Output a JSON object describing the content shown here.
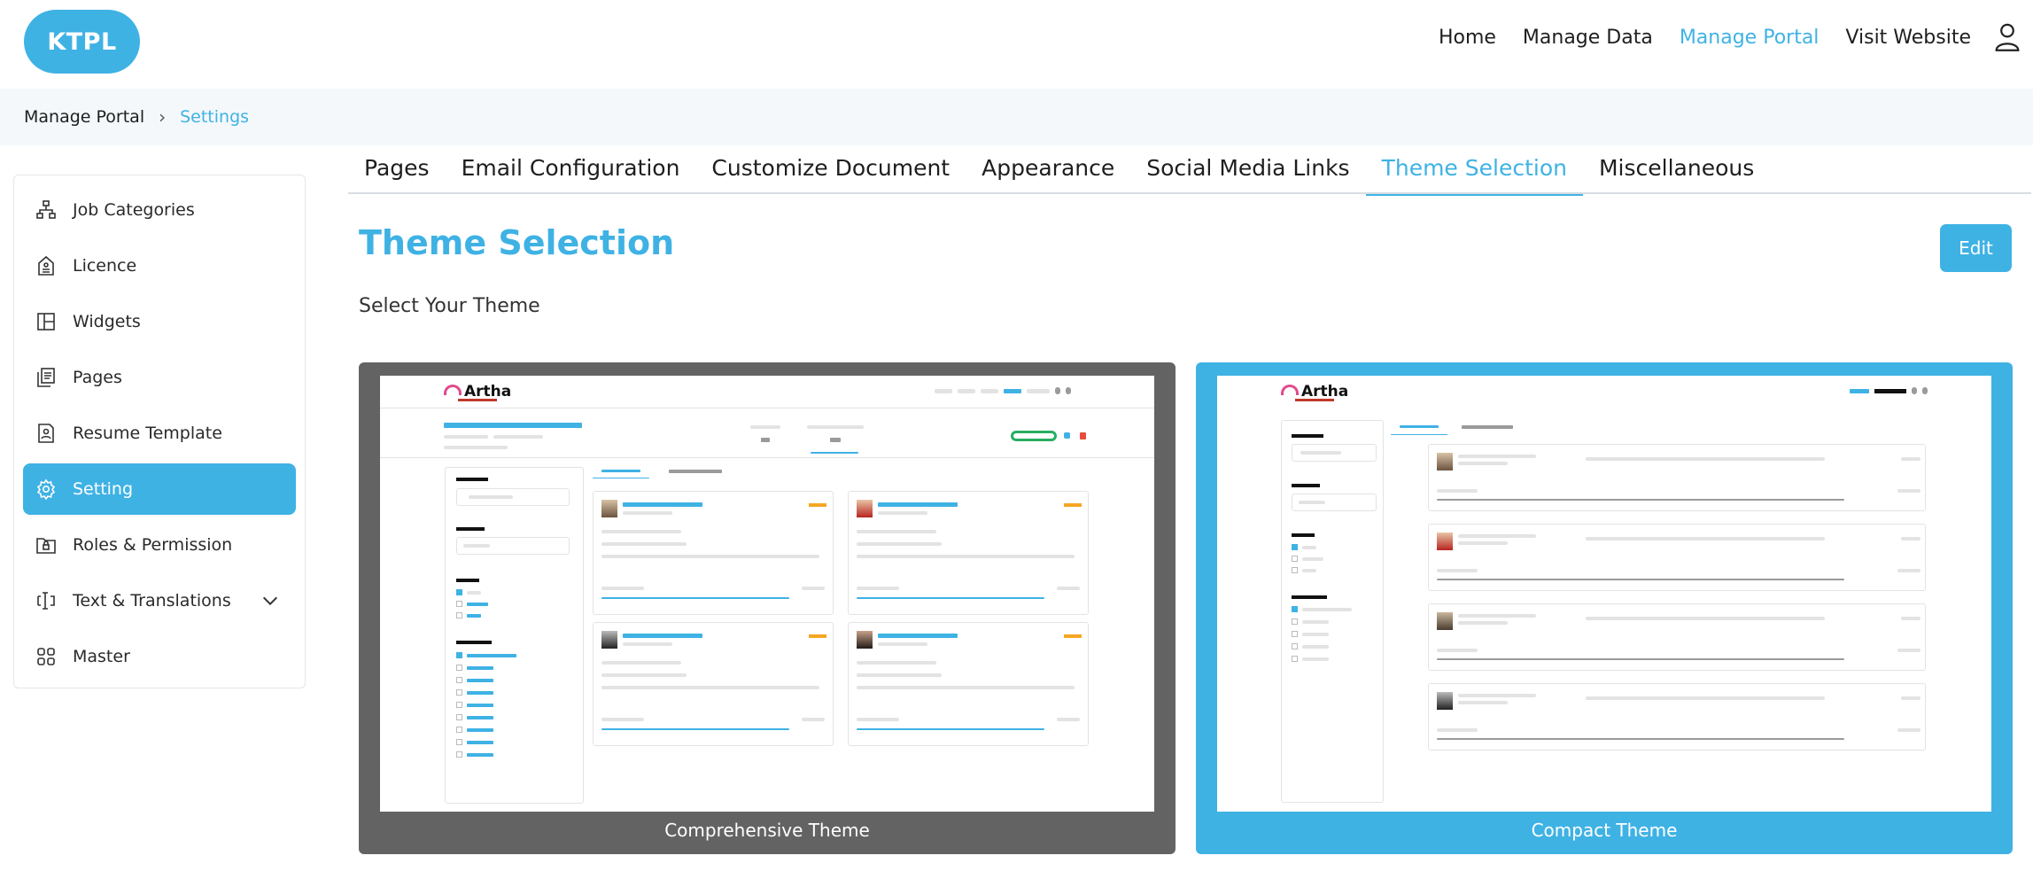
{
  "header": {
    "logo": "KTPL",
    "nav": [
      {
        "label": "Home",
        "active": false
      },
      {
        "label": "Manage Data",
        "active": false
      },
      {
        "label": "Manage Portal",
        "active": true
      },
      {
        "label": "Visit Website",
        "active": false
      }
    ],
    "user_icon": "user-icon"
  },
  "breadcrumb": {
    "parent": "Manage Portal",
    "separator": "›",
    "current": "Settings"
  },
  "sidebar": {
    "items": [
      {
        "label": "Job Categories",
        "icon": "hierarchy-icon",
        "active": false
      },
      {
        "label": "Licence",
        "icon": "document-icon",
        "active": false
      },
      {
        "label": "Widgets",
        "icon": "layout-icon",
        "active": false
      },
      {
        "label": "Pages",
        "icon": "pages-icon",
        "active": false
      },
      {
        "label": "Resume Template",
        "icon": "resume-icon",
        "active": false
      },
      {
        "label": "Setting",
        "icon": "gear-icon",
        "active": true
      },
      {
        "label": "Roles & Permission",
        "icon": "folder-lock-icon",
        "active": false
      },
      {
        "label": "Text & Translations",
        "icon": "text-cursor-icon",
        "active": false,
        "expandable": true
      },
      {
        "label": "Master",
        "icon": "grid-icon",
        "active": false
      }
    ]
  },
  "tabs": [
    {
      "label": "Pages",
      "active": false
    },
    {
      "label": "Email Configuration",
      "active": false
    },
    {
      "label": "Customize Document",
      "active": false
    },
    {
      "label": "Appearance",
      "active": false
    },
    {
      "label": "Social Media Links",
      "active": false
    },
    {
      "label": "Theme Selection",
      "active": true
    },
    {
      "label": "Miscellaneous",
      "active": false
    }
  ],
  "main": {
    "title": "Theme Selection",
    "edit_label": "Edit",
    "subtitle": "Select Your Theme",
    "themes": [
      {
        "caption": "Comprehensive Theme",
        "selected": false,
        "preview_logo": "Artha"
      },
      {
        "caption": "Compact Theme",
        "selected": true,
        "preview_logo": "Artha"
      }
    ]
  },
  "colors": {
    "accent": "#3fb2e4",
    "card_unselected": "#636363",
    "breadcrumb_bg": "#f4f8fb"
  }
}
